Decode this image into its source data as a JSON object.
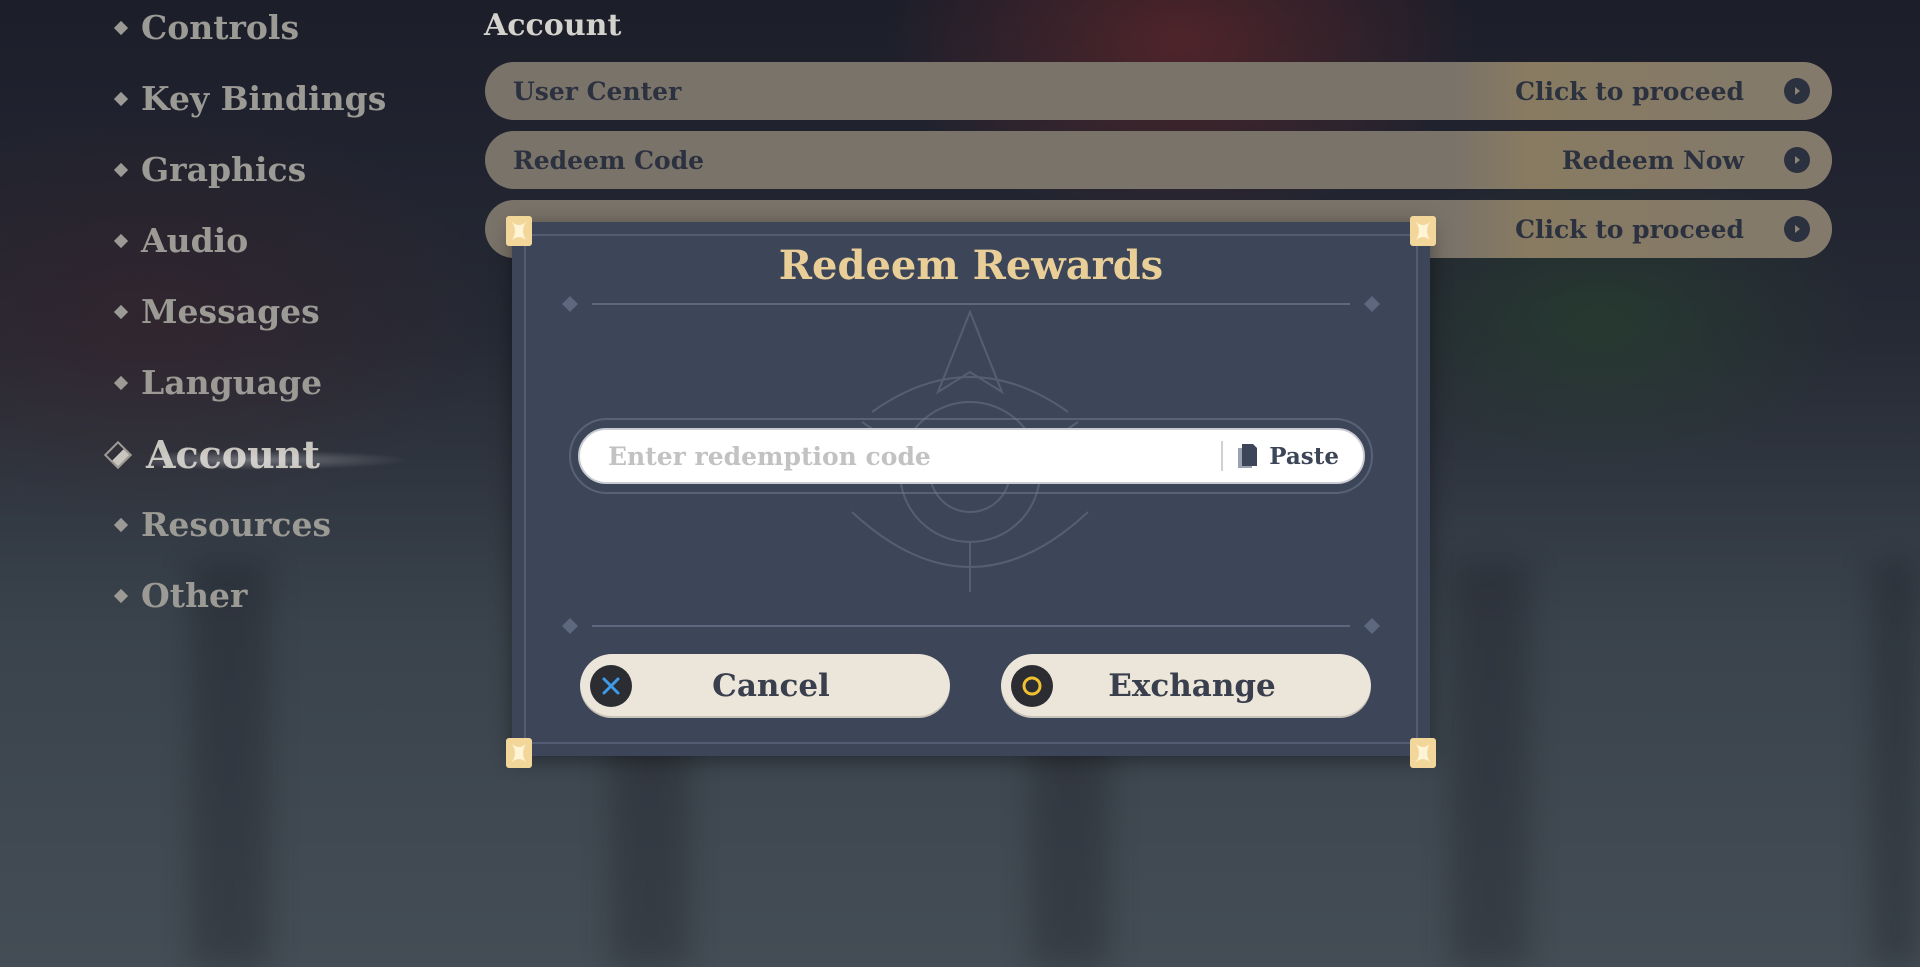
{
  "sidebar": {
    "items": [
      {
        "label": "Controls",
        "active": false
      },
      {
        "label": "Key Bindings",
        "active": false
      },
      {
        "label": "Graphics",
        "active": false
      },
      {
        "label": "Audio",
        "active": false
      },
      {
        "label": "Messages",
        "active": false
      },
      {
        "label": "Language",
        "active": false
      },
      {
        "label": "Account",
        "active": true
      },
      {
        "label": "Resources",
        "active": false
      },
      {
        "label": "Other",
        "active": false
      }
    ]
  },
  "section": {
    "title": "Account",
    "rows": [
      {
        "label": "User Center",
        "action": "Click to proceed",
        "icon": "arrow-right-icon"
      },
      {
        "label": "Redeem Code",
        "action": "Redeem Now",
        "icon": "arrow-right-icon"
      },
      {
        "label": "",
        "action": "Click to proceed",
        "icon": "arrow-right-icon"
      }
    ]
  },
  "dialog": {
    "title": "Redeem Rewards",
    "input": {
      "value": "",
      "placeholder": "Enter redemption code"
    },
    "paste_label": "Paste",
    "paste_icon": "clipboard-icon",
    "cancel": {
      "label": "Cancel",
      "icon": "cross-button-icon",
      "icon_color": "#3d9be9"
    },
    "confirm": {
      "label": "Exchange",
      "icon": "circle-button-icon",
      "icon_color": "#f0c030"
    }
  },
  "colors": {
    "dialog_bg": "#3d4559",
    "title_gold": "#e9cf97",
    "button_bg": "#ece5da",
    "row_bg": "#7a7369",
    "row_text": "#2c3140"
  }
}
